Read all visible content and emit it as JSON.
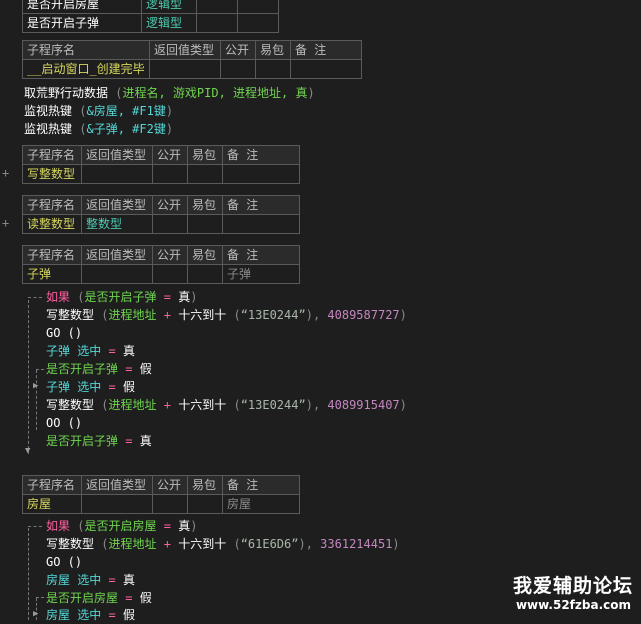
{
  "top_table": {
    "rows": [
      {
        "name": "是否开启房屋",
        "type": "逻辑型"
      },
      {
        "name": "是否开启子弹",
        "type": "逻辑型"
      }
    ]
  },
  "headers": {
    "sub_seq": "子程序名",
    "ret_type": "返回值类型",
    "public": "公开",
    "easy_pkg": "易包",
    "remark": "备 注"
  },
  "sub1": {
    "name": "__启动窗口_创建完毕",
    "code": [
      {
        "fn": "取荒野行动数据",
        "args_open": " (",
        "args": "进程名, 游戏PID, 进程地址, 真",
        "args_close": ")"
      },
      {
        "fn": "监视热键",
        "args_open": " (",
        "args": "&房屋, #F1键",
        "args_close": ")"
      },
      {
        "fn": "监视热键",
        "args_open": " (",
        "args": "&子弹, #F2键",
        "args_close": ")"
      }
    ]
  },
  "sub2": {
    "name": "写整数型"
  },
  "sub3": {
    "name": "读整数型",
    "type": "整数型"
  },
  "sub4": {
    "name": "子弹",
    "remark": "子弹",
    "code": {
      "if_kw": "如果",
      "cond_var": "是否开启子弹",
      "eq": "=",
      "true_kw": "真",
      "false_kw": "假",
      "write_fn": "写整数型",
      "addr": "进程地址",
      "plus": "+",
      "hex_fn": "十六到十",
      "hex1": "“13E0244”",
      "val1": "4089587727",
      "go": "GO ()",
      "sel": "子弹 选中",
      "hex2": "“13E0244”",
      "val2": "4089915407",
      "oo": "OO ()"
    }
  },
  "sub5": {
    "name": "房屋",
    "remark": "房屋",
    "code": {
      "if_kw": "如果",
      "cond_var": "是否开启房屋",
      "eq": "=",
      "true_kw": "真",
      "false_kw": "假",
      "write_fn": "写整数型",
      "addr": "进程地址",
      "plus": "+",
      "hex_fn": "十六到十",
      "hex1": "“61E6D6”",
      "val1": "3361214451",
      "go": "GO ()",
      "sel": "房屋 选中"
    }
  },
  "expander": "+",
  "watermark": {
    "title": "我爱辅助论坛",
    "url": "www.52fzba.com"
  }
}
